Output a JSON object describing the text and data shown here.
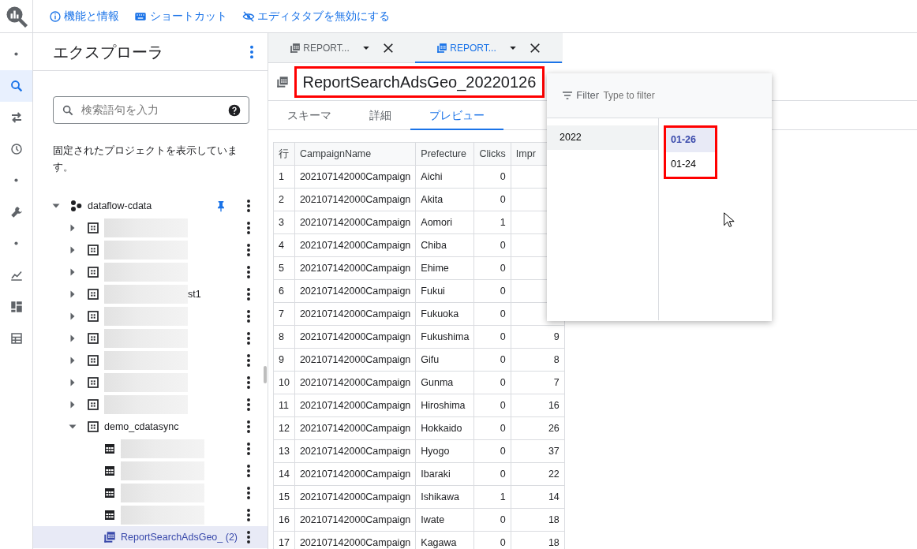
{
  "toolbar": {
    "links": [
      {
        "label": "機能と情報"
      },
      {
        "label": "ショートカット"
      },
      {
        "label": "エディタタブを無効にする"
      }
    ]
  },
  "rail": [
    {
      "selected": false
    },
    {
      "selected": true
    },
    {
      "selected": false
    },
    {
      "selected": false
    },
    {
      "selected": false
    },
    {
      "selected": false
    },
    {
      "selected": false
    },
    {
      "selected": false
    },
    {
      "selected": false
    },
    {
      "selected": false
    }
  ],
  "explorer": {
    "title": "エクスプローラ",
    "search": {
      "placeholder": "検索語句を入力"
    },
    "pinned_note": "固定されたプロジェクトを表示しています。",
    "tree": [
      {
        "kind": "project",
        "label": "dataflow-cdata",
        "expanded": true,
        "pinned": true,
        "selected": false,
        "children": [
          {
            "kind": "dataset",
            "expanded": false,
            "redacted": true,
            "selected": false
          },
          {
            "kind": "dataset",
            "expanded": false,
            "redacted": true,
            "selected": false
          },
          {
            "kind": "dataset",
            "expanded": false,
            "redacted": true,
            "selected": false
          },
          {
            "kind": "dataset",
            "label": "st1",
            "expanded": false,
            "redacted": true,
            "selected": false
          },
          {
            "kind": "dataset",
            "expanded": false,
            "redacted": true,
            "selected": false
          },
          {
            "kind": "dataset",
            "expanded": false,
            "redacted": true,
            "selected": false
          },
          {
            "kind": "dataset",
            "expanded": false,
            "redacted": true,
            "selected": false
          },
          {
            "kind": "dataset",
            "expanded": false,
            "redacted": true,
            "selected": false
          },
          {
            "kind": "dataset",
            "expanded": false,
            "redacted": true,
            "selected": false
          },
          {
            "kind": "dataset",
            "label": "demo_cdatasync",
            "expanded": true,
            "selected": false,
            "children": [
              {
                "kind": "table",
                "redacted": true,
                "selected": false
              },
              {
                "kind": "table",
                "redacted": true,
                "selected": false
              },
              {
                "kind": "table",
                "redacted": true,
                "selected": false
              },
              {
                "kind": "table",
                "redacted": true,
                "selected": false
              },
              {
                "kind": "sharded",
                "label": "ReportSearchAdsGeo_ (2)",
                "selected": true
              }
            ]
          }
        ]
      }
    ]
  },
  "editor_tabs": [
    {
      "label": "REPORT...",
      "selected": false
    },
    {
      "label": "REPORT...",
      "selected": true
    }
  ],
  "title": {
    "text": "ReportSearchAdsGeo_20220126",
    "highlighted": true
  },
  "detail_tabs": [
    {
      "label": "スキーマ",
      "selected": false
    },
    {
      "label": "詳細",
      "selected": false
    },
    {
      "label": "プレビュー",
      "selected": true
    }
  ],
  "preview": {
    "columns": [
      "行",
      "CampaignName",
      "Prefecture",
      "Clicks",
      "Impr"
    ],
    "rows": [
      [
        "1",
        "202107142000Campaign",
        "Aichi",
        "0"
      ],
      [
        "2",
        "202107142000Campaign",
        "Akita",
        "0"
      ],
      [
        "3",
        "202107142000Campaign",
        "Aomori",
        "1"
      ],
      [
        "4",
        "202107142000Campaign",
        "Chiba",
        "0"
      ],
      [
        "5",
        "202107142000Campaign",
        "Ehime",
        "0"
      ],
      [
        "6",
        "202107142000Campaign",
        "Fukui",
        "0"
      ],
      [
        "7",
        "202107142000Campaign",
        "Fukuoka",
        "0"
      ],
      [
        "8",
        "202107142000Campaign",
        "Fukushima",
        "0",
        "9"
      ],
      [
        "9",
        "202107142000Campaign",
        "Gifu",
        "0",
        "8"
      ],
      [
        "10",
        "202107142000Campaign",
        "Gunma",
        "0",
        "7"
      ],
      [
        "11",
        "202107142000Campaign",
        "Hiroshima",
        "0",
        "16"
      ],
      [
        "12",
        "202107142000Campaign",
        "Hokkaido",
        "0",
        "26"
      ],
      [
        "13",
        "202107142000Campaign",
        "Hyogo",
        "0",
        "37"
      ],
      [
        "14",
        "202107142000Campaign",
        "Ibaraki",
        "0",
        "22"
      ],
      [
        "15",
        "202107142000Campaign",
        "Ishikawa",
        "1",
        "14"
      ],
      [
        "16",
        "202107142000Campaign",
        "Iwate",
        "0",
        "18"
      ],
      [
        "17",
        "202107142000Campaign",
        "Kagawa",
        "0",
        "18"
      ]
    ]
  },
  "date_picker": {
    "filter_label": "Filter",
    "placeholder": "Type to filter",
    "years": [
      {
        "label": "2022",
        "selected": true
      }
    ],
    "dates_highlighted": true,
    "dates": [
      {
        "label": "01-26",
        "selected": true
      },
      {
        "label": "01-24",
        "selected": false
      }
    ]
  }
}
